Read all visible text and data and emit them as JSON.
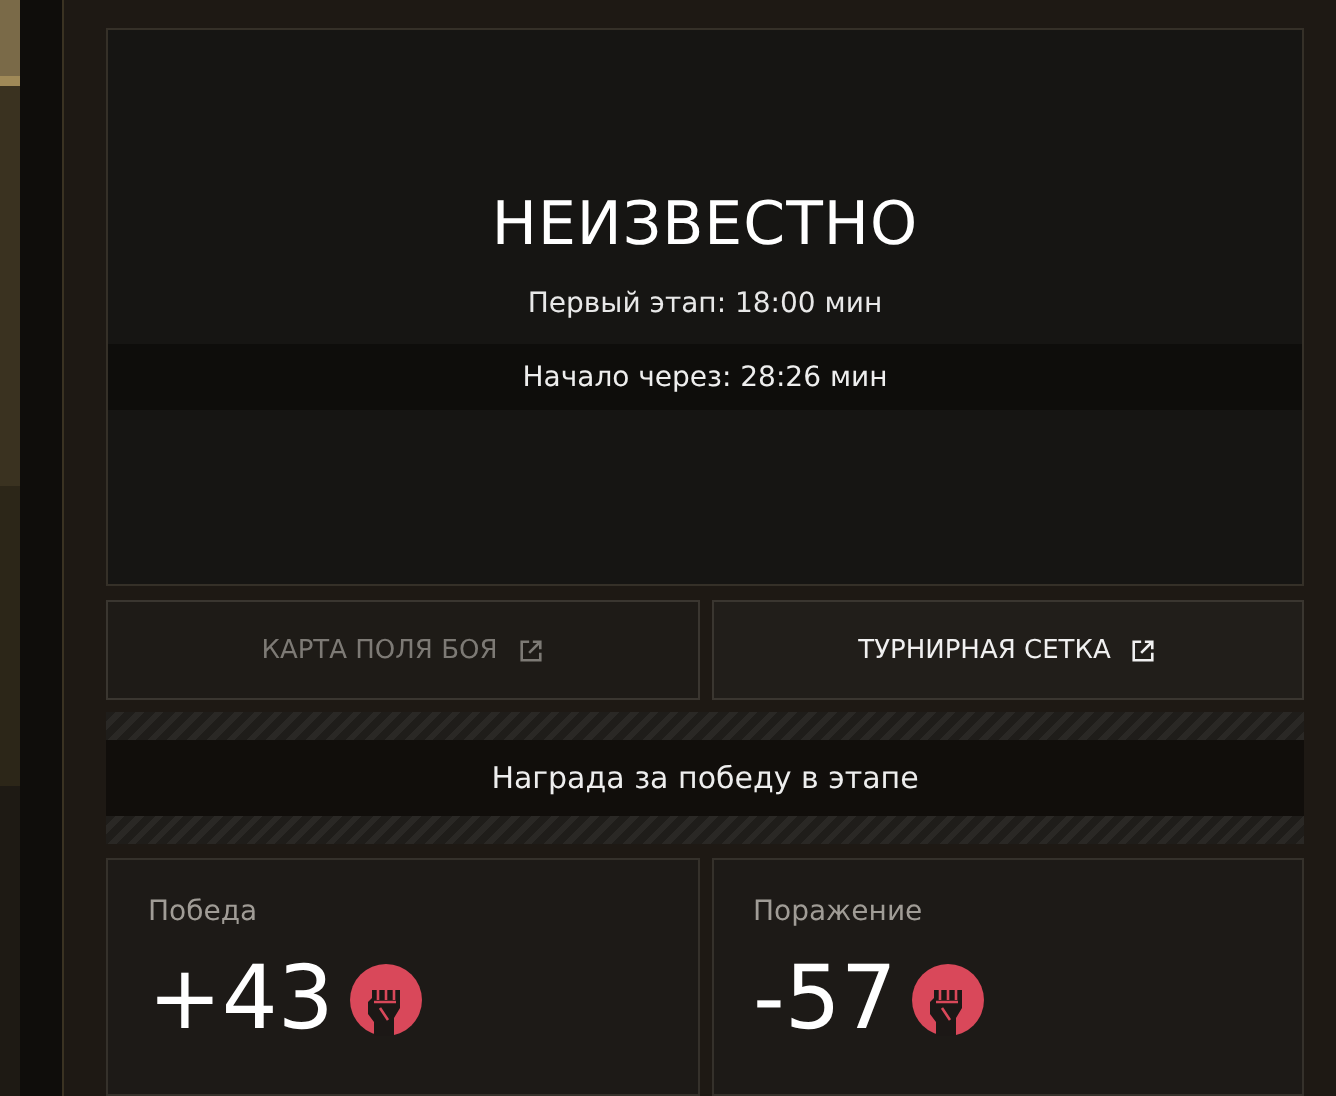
{
  "status": {
    "title": "НЕИЗВЕСТНО",
    "first_stage": "Первый этап: 18:00 мин",
    "countdown": "Начало через: 28:26 мин"
  },
  "links": [
    {
      "label": "КАРТА ПОЛЯ БОЯ",
      "disabled": true
    },
    {
      "label": "ТУРНИРНАЯ СЕТКА",
      "disabled": false
    }
  ],
  "reward": {
    "title": "Награда за победу в этапе"
  },
  "results": [
    {
      "label": "Победа",
      "value": "+43"
    },
    {
      "label": "Поражение",
      "value": "-57"
    }
  ]
}
